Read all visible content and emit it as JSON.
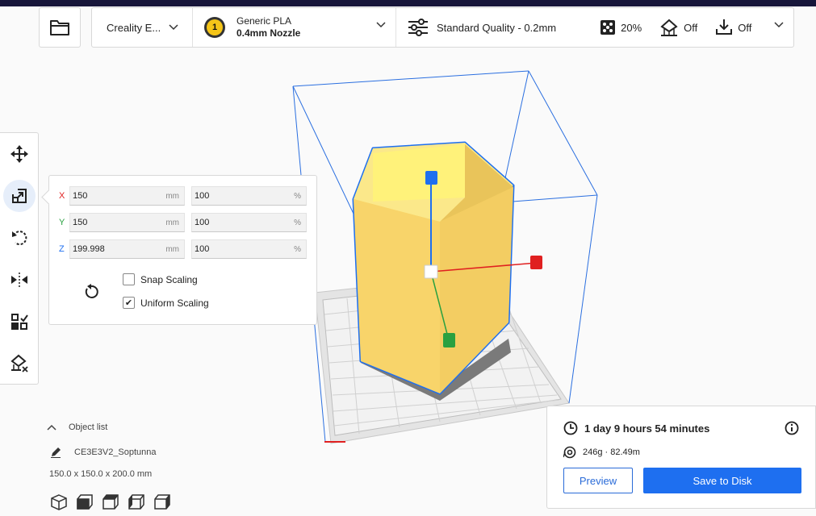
{
  "header": {
    "printer_name": "Creality E...",
    "extruder_number": "1",
    "material_name": "Generic PLA",
    "nozzle": "0.4mm Nozzle",
    "quality": "Standard Quality - 0.2mm",
    "infill": "20%",
    "support": "Off",
    "adhesion": "Off"
  },
  "tools": [
    "move-tool",
    "scale-tool",
    "rotate-tool",
    "mirror-tool",
    "per-model-settings-tool",
    "support-blocker-tool"
  ],
  "scale_panel": {
    "x": {
      "label": "X",
      "mm": "150",
      "mm_unit": "mm",
      "pct": "100",
      "pct_unit": "%"
    },
    "y": {
      "label": "Y",
      "mm": "150",
      "mm_unit": "mm",
      "pct": "100",
      "pct_unit": "%"
    },
    "z": {
      "label": "Z",
      "mm": "199.998",
      "mm_unit": "mm",
      "pct": "100",
      "pct_unit": "%"
    },
    "snap_scaling": {
      "label": "Snap Scaling",
      "checked": false
    },
    "uniform_scaling": {
      "label": "Uniform Scaling",
      "checked": true,
      "mark": "✔"
    }
  },
  "object_list": {
    "title": "Object list",
    "object_name": "CE3E3V2_Soptunna",
    "dimensions": "150.0 x 150.0 x 200.0 mm"
  },
  "print_info": {
    "time": "1 day 9 hours 54 minutes",
    "material": "246g · 82.49m",
    "preview_label": "Preview",
    "save_label": "Save to Disk"
  },
  "colors": {
    "accent": "#1e6ff0",
    "model": "#f7d35e",
    "axis_x": "#e02020",
    "axis_y": "#2aa040",
    "axis_z": "#1e6ff0"
  }
}
